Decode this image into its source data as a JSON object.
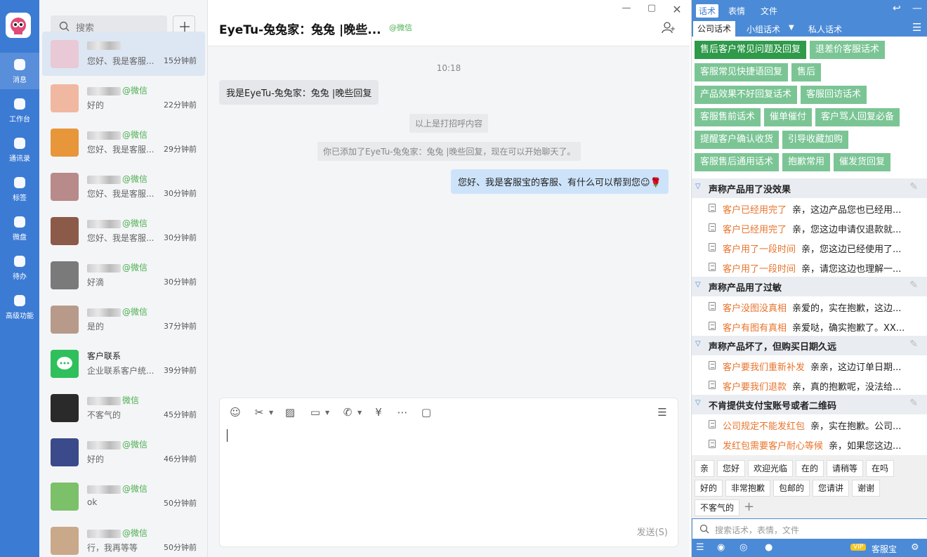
{
  "nav": {
    "items": [
      {
        "label": "消息",
        "icon": "chat-bubble-icon"
      },
      {
        "label": "工作台",
        "icon": "grid-icon"
      },
      {
        "label": "通讯录",
        "icon": "org-chart-icon"
      },
      {
        "label": "标签",
        "icon": "tag-icon"
      },
      {
        "label": "微盘",
        "icon": "hexagon-drive-icon"
      },
      {
        "label": "待办",
        "icon": "checkmark-icon"
      },
      {
        "label": "高级功能",
        "icon": "sparkle-icon"
      }
    ]
  },
  "search": {
    "placeholder": "搜索"
  },
  "contacts": [
    {
      "name": "",
      "source": "",
      "preview": "您好、我是客服...",
      "time": "15分钟前",
      "active": true,
      "color": "#e9c9d6"
    },
    {
      "name": "",
      "source": "@微信",
      "preview": "好的",
      "time": "22分钟前",
      "color": "#f0b8a0"
    },
    {
      "name": "",
      "source": "@微信",
      "preview": "您好、我是客服...",
      "time": "29分钟前",
      "color": "#e8963a"
    },
    {
      "name": "",
      "source": "@微信",
      "preview": "您好、我是客服...",
      "time": "30分钟前",
      "color": "#b88a8a"
    },
    {
      "name": "",
      "source": "@微信",
      "preview": "您好、我是客服...",
      "time": "30分钟前",
      "color": "#8c5a48"
    },
    {
      "name": "",
      "source": "@微信",
      "preview": "好滴",
      "time": "30分钟前",
      "color": "#7a7a7a"
    },
    {
      "name": "",
      "source": "@微信",
      "preview": "是的",
      "time": "37分钟前",
      "color": "#b89a8a"
    },
    {
      "name": "客户联系",
      "source": "",
      "preview": "企业联系客户统...",
      "time": "39分钟前",
      "color": "#2fbf5b"
    },
    {
      "name": "",
      "source": "微信",
      "preview": "不客气的",
      "time": "45分钟前",
      "color": "#2a2a2a"
    },
    {
      "name": "",
      "source": "@微信",
      "preview": "好的",
      "time": "46分钟前",
      "color": "#3a4a8a"
    },
    {
      "name": "",
      "source": "@微信",
      "preview": "ok",
      "time": "50分钟前",
      "color": "#7cc06a"
    },
    {
      "name": "",
      "source": "@微信",
      "preview": "行，我再等等",
      "time": "50分钟前",
      "color": "#c9a98a"
    }
  ],
  "chat": {
    "title": "EyeTu-兔兔家：兔兔 |晚些...",
    "source": "@微信",
    "time": "10:18",
    "incoming": "我是EyeTu-兔兔家：兔兔 |晚些回复",
    "sys1": "以上是打招呼内容",
    "sys2": "你已添加了EyeTu-兔兔家：兔兔 |晚些回复，现在可以开始聊天了。",
    "outgoing": "您好、我是客服宝的客服、有什么可以帮到您☺🌹",
    "send": "发送(S)"
  },
  "panel": {
    "tabs": [
      "话术",
      "表情",
      "文件"
    ],
    "subtabs": [
      "公司话术",
      "小组话术",
      "私人话术"
    ],
    "groups": [
      "售后客户常见问题及回复",
      "退差价客服话术",
      "客服常见快捷语回复",
      "售后",
      "产品效果不好回复话术",
      "客服回访话术",
      "客服售前话术",
      "催单催付",
      "客户骂人回复必备",
      "提醒客户确认收货",
      "引导收藏加购",
      "客服售后通用话术",
      "抱歉常用",
      "催发货回复"
    ],
    "sections": [
      {
        "title": "声称产品用了没效果",
        "items": [
          {
            "k": "客户已经用完了",
            "v": "亲，这边产品您也已经用..."
          },
          {
            "k": "客户已经用完了",
            "v": "亲，您这边申请仅退款就..."
          },
          {
            "k": "客户用了一段时间",
            "v": "亲，您这边已经使用了..."
          },
          {
            "k": "客户用了一段时间",
            "v": "亲，请您这边也理解一..."
          }
        ]
      },
      {
        "title": "声称产品用了过敏",
        "items": [
          {
            "k": "客户没图没真相",
            "v": "亲爱的，实在抱歉，这边..."
          },
          {
            "k": "客户有图有真相",
            "v": "亲爱哒，确实抱歉了。XX..."
          }
        ]
      },
      {
        "title": "声称产品坏了，但购买日期久远",
        "items": [
          {
            "k": "客户要我们重新补发",
            "v": "亲亲，这边订单日期..."
          },
          {
            "k": "客户要我们退款",
            "v": "亲，真的抱歉呢，没法给..."
          }
        ]
      },
      {
        "title": "不肯提供支付宝账号或者二维码",
        "items": [
          {
            "k": "公司规定不能发红包",
            "v": "亲，实在抱歉。公司..."
          },
          {
            "k": "发红包需要客户耐心等候",
            "v": "亲，如果您这边..."
          }
        ]
      }
    ],
    "quick": [
      "亲",
      "您好",
      "欢迎光临",
      "在的",
      "请稍等",
      "在吗",
      "好的",
      "非常抱歉",
      "包邮的",
      "您请讲",
      "谢谢",
      "不客气的"
    ],
    "search_placeholder": "搜索话术，表情，文件",
    "vip": "VIP",
    "brand": "客服宝"
  }
}
